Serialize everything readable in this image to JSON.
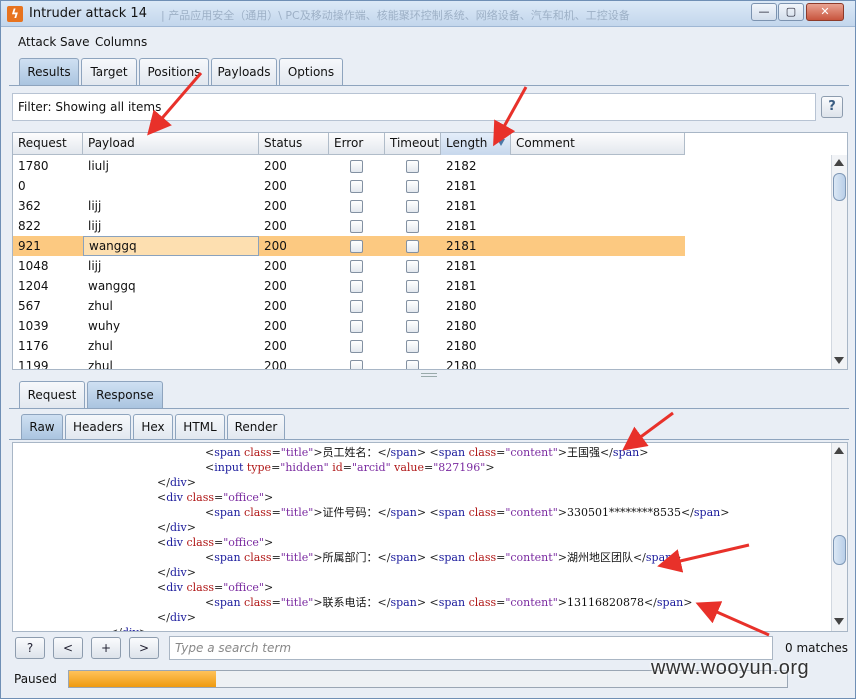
{
  "window": {
    "title": "Intruder attack 14",
    "background_title": "| 产品应用安全（通用）\\ PC及移动操作端、核能聚环控制系统、网络设备、汽车和机、工控设备"
  },
  "menu": [
    "Attack",
    "Save",
    "Columns"
  ],
  "main_tabs": [
    "Results",
    "Target",
    "Positions",
    "Payloads",
    "Options"
  ],
  "filter": {
    "label": "Filter: Showing all items",
    "help": "?"
  },
  "table": {
    "columns": [
      "Request",
      "Payload",
      "Status",
      "Error",
      "Timeout",
      "Length",
      "Comment"
    ],
    "rows": [
      {
        "request": "1780",
        "payload": "liulj",
        "status": "200",
        "length": "2182"
      },
      {
        "request": "0",
        "payload": "",
        "status": "200",
        "length": "2181"
      },
      {
        "request": "362",
        "payload": "lijj",
        "status": "200",
        "length": "2181"
      },
      {
        "request": "822",
        "payload": "lijj",
        "status": "200",
        "length": "2181"
      },
      {
        "request": "921",
        "payload": "wanggq",
        "status": "200",
        "length": "2181",
        "selected": true
      },
      {
        "request": "1048",
        "payload": "lijj",
        "status": "200",
        "length": "2181"
      },
      {
        "request": "1204",
        "payload": "wanggq",
        "status": "200",
        "length": "2181"
      },
      {
        "request": "567",
        "payload": "zhul",
        "status": "200",
        "length": "2180"
      },
      {
        "request": "1039",
        "payload": "wuhy",
        "status": "200",
        "length": "2180"
      },
      {
        "request": "1176",
        "payload": "zhul",
        "status": "200",
        "length": "2180"
      },
      {
        "request": "1199",
        "payload": "zhul",
        "status": "200",
        "length": "2180"
      }
    ]
  },
  "rr_tabs": [
    "Request",
    "Response"
  ],
  "view_tabs": [
    "Raw",
    "Headers",
    "Hex",
    "HTML",
    "Render"
  ],
  "code_lines": [
    {
      "indent": 192,
      "parts": [
        [
          "tg",
          "<"
        ],
        [
          "kw",
          "span "
        ],
        [
          "at",
          "class"
        ],
        [
          "tg",
          "="
        ],
        [
          "vl",
          "\"title\""
        ],
        [
          "tg",
          ">"
        ],
        [
          "tx",
          "员工姓名："
        ],
        [
          "tg",
          "</"
        ],
        [
          "kw",
          "span"
        ],
        [
          "tg",
          "> <"
        ],
        [
          "kw",
          "span "
        ],
        [
          "at",
          "class"
        ],
        [
          "tg",
          "="
        ],
        [
          "vl",
          "\"content\""
        ],
        [
          "tg",
          ">"
        ],
        [
          "tx",
          "王国强"
        ],
        [
          "tg",
          "</"
        ],
        [
          "kw",
          "span"
        ],
        [
          "tg",
          ">"
        ]
      ]
    },
    {
      "indent": 192,
      "parts": [
        [
          "tg",
          "<"
        ],
        [
          "kw",
          "input "
        ],
        [
          "at",
          "type"
        ],
        [
          "tg",
          "="
        ],
        [
          "vl",
          "\"hidden\" "
        ],
        [
          "at",
          "id"
        ],
        [
          "tg",
          "="
        ],
        [
          "vl",
          "\"arcid\" "
        ],
        [
          "at",
          "value"
        ],
        [
          "tg",
          "="
        ],
        [
          "vl",
          "\"827196\""
        ],
        [
          "tg",
          ">"
        ]
      ]
    },
    {
      "indent": 144,
      "parts": [
        [
          "tg",
          "</"
        ],
        [
          "kw",
          "div"
        ],
        [
          "tg",
          ">"
        ]
      ]
    },
    {
      "indent": 144,
      "parts": [
        [
          "tg",
          "<"
        ],
        [
          "kw",
          "div "
        ],
        [
          "at",
          "class"
        ],
        [
          "tg",
          "="
        ],
        [
          "vl",
          "\"office\""
        ],
        [
          "tg",
          ">"
        ]
      ]
    },
    {
      "indent": 192,
      "parts": [
        [
          "tg",
          "<"
        ],
        [
          "kw",
          "span "
        ],
        [
          "at",
          "class"
        ],
        [
          "tg",
          "="
        ],
        [
          "vl",
          "\"title\""
        ],
        [
          "tg",
          ">"
        ],
        [
          "tx",
          "证件号码："
        ],
        [
          "tg",
          "</"
        ],
        [
          "kw",
          "span"
        ],
        [
          "tg",
          "> <"
        ],
        [
          "kw",
          "span "
        ],
        [
          "at",
          "class"
        ],
        [
          "tg",
          "="
        ],
        [
          "vl",
          "\"content\""
        ],
        [
          "tg",
          ">"
        ],
        [
          "tx",
          "330501********8535"
        ],
        [
          "tg",
          "</"
        ],
        [
          "kw",
          "span"
        ],
        [
          "tg",
          ">"
        ]
      ]
    },
    {
      "indent": 144,
      "parts": [
        [
          "tg",
          "</"
        ],
        [
          "kw",
          "div"
        ],
        [
          "tg",
          ">"
        ]
      ]
    },
    {
      "indent": 144,
      "parts": [
        [
          "tg",
          "<"
        ],
        [
          "kw",
          "div "
        ],
        [
          "at",
          "class"
        ],
        [
          "tg",
          "="
        ],
        [
          "vl",
          "\"office\""
        ],
        [
          "tg",
          ">"
        ]
      ]
    },
    {
      "indent": 192,
      "parts": [
        [
          "tg",
          "<"
        ],
        [
          "kw",
          "span "
        ],
        [
          "at",
          "class"
        ],
        [
          "tg",
          "="
        ],
        [
          "vl",
          "\"title\""
        ],
        [
          "tg",
          ">"
        ],
        [
          "tx",
          "所属部门："
        ],
        [
          "tg",
          "</"
        ],
        [
          "kw",
          "span"
        ],
        [
          "tg",
          "> <"
        ],
        [
          "kw",
          "span "
        ],
        [
          "at",
          "class"
        ],
        [
          "tg",
          "="
        ],
        [
          "vl",
          "\"content\""
        ],
        [
          "tg",
          ">"
        ],
        [
          "tx",
          "湖州地区团队"
        ],
        [
          "tg",
          "</"
        ],
        [
          "kw",
          "span"
        ],
        [
          "tg",
          ">"
        ]
      ]
    },
    {
      "indent": 144,
      "parts": [
        [
          "tg",
          "</"
        ],
        [
          "kw",
          "div"
        ],
        [
          "tg",
          ">"
        ]
      ]
    },
    {
      "indent": 144,
      "parts": [
        [
          "tg",
          "<"
        ],
        [
          "kw",
          "div "
        ],
        [
          "at",
          "class"
        ],
        [
          "tg",
          "="
        ],
        [
          "vl",
          "\"office\""
        ],
        [
          "tg",
          ">"
        ]
      ]
    },
    {
      "indent": 192,
      "parts": [
        [
          "tg",
          "<"
        ],
        [
          "kw",
          "span "
        ],
        [
          "at",
          "class"
        ],
        [
          "tg",
          "="
        ],
        [
          "vl",
          "\"title\""
        ],
        [
          "tg",
          ">"
        ],
        [
          "tx",
          "联系电话："
        ],
        [
          "tg",
          "</"
        ],
        [
          "kw",
          "span"
        ],
        [
          "tg",
          "> <"
        ],
        [
          "kw",
          "span "
        ],
        [
          "at",
          "class"
        ],
        [
          "tg",
          "="
        ],
        [
          "vl",
          "\"content\""
        ],
        [
          "tg",
          ">"
        ],
        [
          "tx",
          "13116820878"
        ],
        [
          "tg",
          "</"
        ],
        [
          "kw",
          "span"
        ],
        [
          "tg",
          ">"
        ]
      ]
    },
    {
      "indent": 144,
      "parts": [
        [
          "tg",
          "</"
        ],
        [
          "kw",
          "div"
        ],
        [
          "tg",
          ">"
        ]
      ]
    },
    {
      "indent": 96,
      "parts": [
        [
          "tg",
          "</"
        ],
        [
          "kw",
          "div"
        ],
        [
          "tg",
          ">"
        ]
      ]
    }
  ],
  "search": {
    "placeholder": "Type a search term",
    "help": "?",
    "prev": "<",
    "add": "+",
    "next": ">",
    "matches": "0 matches"
  },
  "status": {
    "label": "Paused",
    "progress_percent": 20.5
  },
  "watermark": "www.wooyun.org",
  "colors": {
    "selected_row": "#fcc981",
    "progress": "#ef9a10",
    "arrow": "#e8312a"
  }
}
